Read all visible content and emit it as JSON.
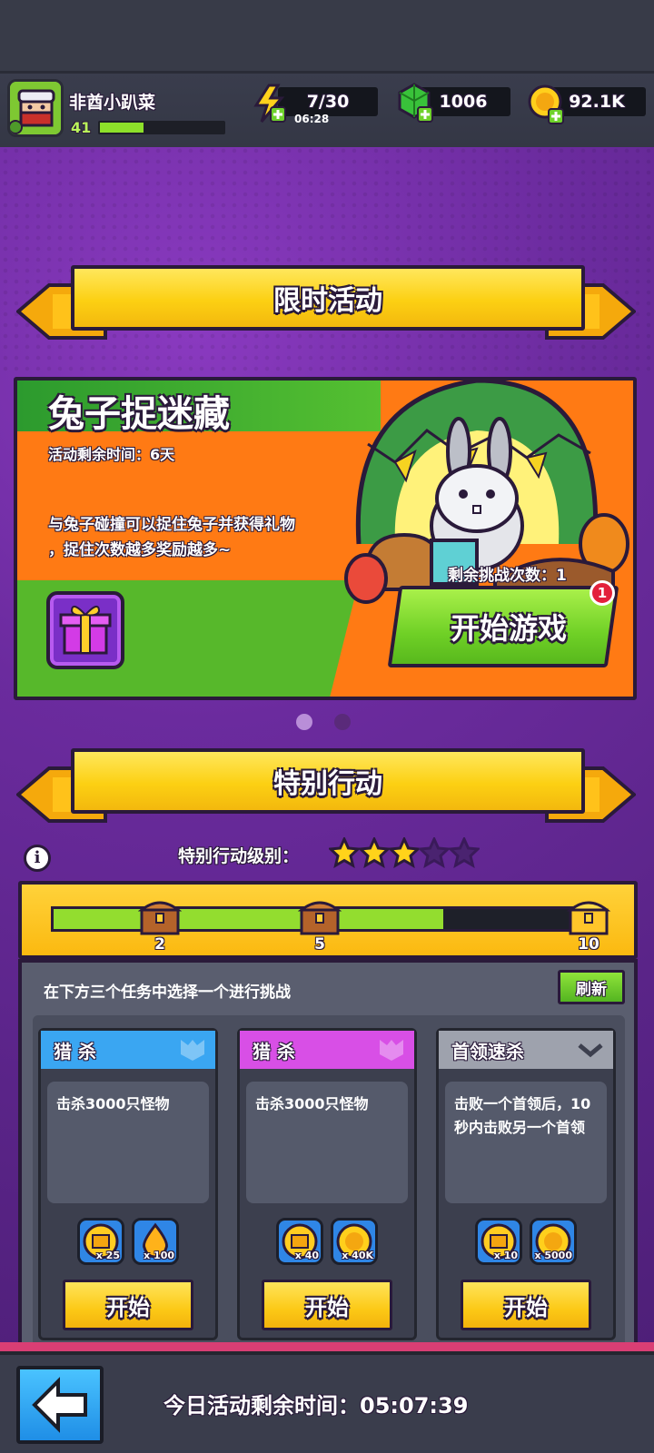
{
  "player": {
    "name": "非酋小趴菜",
    "level": "41",
    "xp_fraction": 0.35
  },
  "resources": {
    "energy": "7/30",
    "energy_timer": "06:28",
    "gems": "1006",
    "coins": "92.1K"
  },
  "limited_event": {
    "header": "限时活动",
    "title": "兔子捉迷藏",
    "remaining_time": "活动剩余时间：6天",
    "desc_line1": "与兔子碰撞可以捉住兔子并获得礼物",
    "desc_line2": "，捉住次数越多奖励越多~",
    "challenges_left": "剩余挑战次数：1",
    "start_button": "开始游戏",
    "notification_badge": "1",
    "page_dots": 2,
    "active_dot": 0
  },
  "special_action": {
    "header": "特别行动",
    "level_label": "特别行动级别：",
    "stars_filled": 3,
    "stars_total": 5,
    "progress": {
      "milestones": [
        "2",
        "5",
        "10"
      ],
      "fraction": 0.72
    },
    "instructions": "在下方三个任务中选择一个进行挑战",
    "refresh_button": "刷新",
    "tasks": [
      {
        "type": "猎 杀",
        "desc": "击杀3000只怪物",
        "color": "#3aa6f2",
        "rewards": [
          {
            "icon": "gold-chest-icon",
            "count": "x 25"
          },
          {
            "icon": "gold-drop-icon",
            "count": "x 100"
          }
        ],
        "start": "开始"
      },
      {
        "type": "猎 杀",
        "desc": "击杀3000只怪物",
        "color": "#d84fe6",
        "rewards": [
          {
            "icon": "gold-chest-icon",
            "count": "x 40"
          },
          {
            "icon": "coin-icon",
            "count": "x 40K"
          }
        ],
        "start": "开始"
      },
      {
        "type": "首领速杀",
        "desc": "击败一个首领后，10秒内击败另一个首领",
        "color": "#9ea2ad",
        "rewards": [
          {
            "icon": "gold-chest-icon",
            "count": "x 10"
          },
          {
            "icon": "coin-icon",
            "count": "x 5000"
          }
        ],
        "start": "开始"
      }
    ]
  },
  "footer": {
    "remaining_label": "今日活动剩余时间：05:07:39"
  }
}
